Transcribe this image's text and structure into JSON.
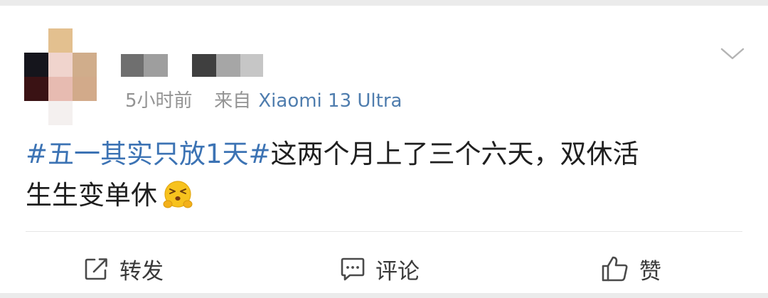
{
  "post": {
    "time": "5小时前",
    "source_prefix": "来自",
    "source_device": "Xiaomi 13 Ultra",
    "topic": "#五一其实只放1天#",
    "text_line1": "这两个月上了三个六天，双休活",
    "text_line2": "生生变单休"
  },
  "actions": {
    "repost": "转发",
    "comment": "评论",
    "like": "赞"
  },
  "colors": {
    "background": "#ebebeb",
    "card": "#ffffff",
    "topic_link": "#3c73b4",
    "source_link": "#4f7dae",
    "meta_gray": "#939393",
    "text": "#1f1f1f"
  },
  "icons": {
    "menu": "chevron-down-icon",
    "repost": "share-icon",
    "comment": "comment-icon",
    "like": "thumbs-up-icon",
    "emoji": "angry-emoji"
  }
}
